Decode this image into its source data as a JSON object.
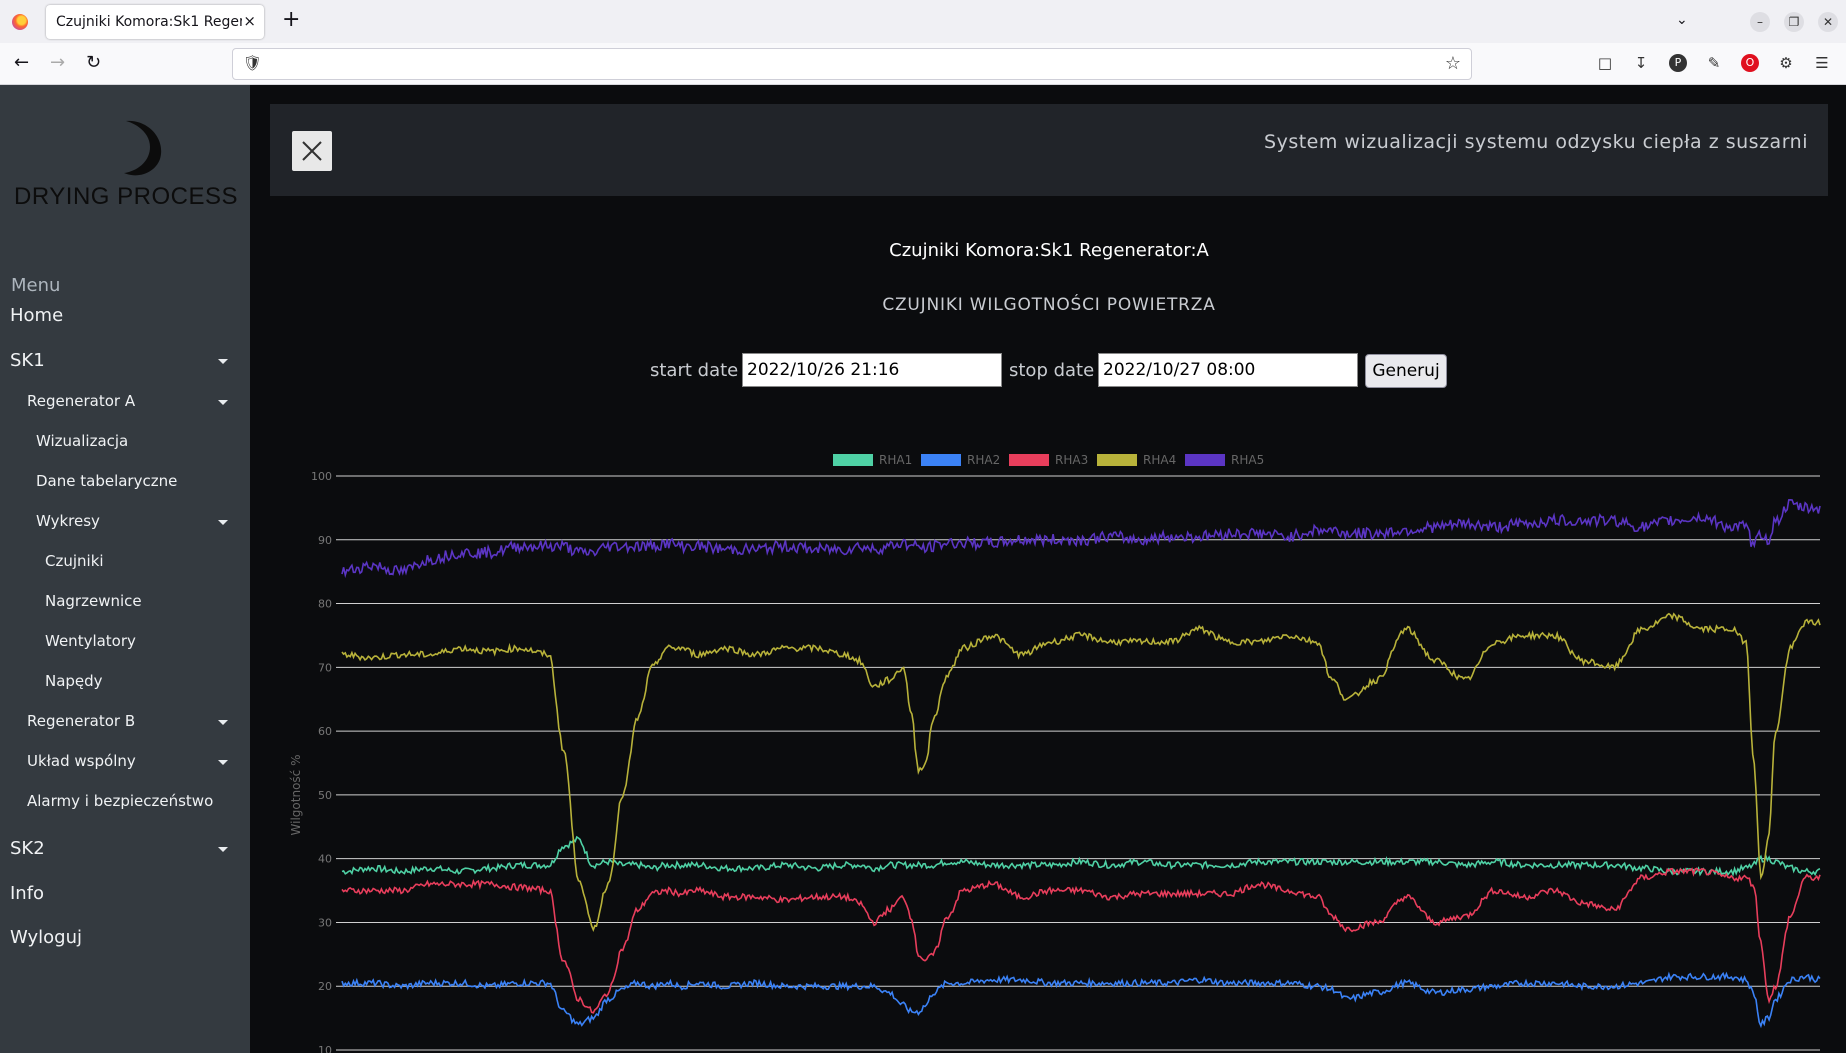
{
  "browser": {
    "tab_title": "Czujniki Komora:Sk1 Regenerator:A",
    "tab_close": "×",
    "new_tab": "+",
    "url": ""
  },
  "sidebar": {
    "brand": "DRYING PROCESS",
    "menu_label": "Menu",
    "items": [
      {
        "label": "Home",
        "level": 0,
        "caret": false
      },
      {
        "label": "SK1",
        "level": 0,
        "caret": true
      },
      {
        "label": "Regenerator A",
        "level": 1,
        "caret": true
      },
      {
        "label": "Wizualizacja",
        "level": 2,
        "caret": false
      },
      {
        "label": "Dane tabelaryczne",
        "level": 2,
        "caret": false
      },
      {
        "label": "Wykresy",
        "level": 2,
        "caret": true
      },
      {
        "label": "Czujniki",
        "level": 3,
        "caret": false
      },
      {
        "label": "Nagrzewnice",
        "level": 3,
        "caret": false
      },
      {
        "label": "Wentylatory",
        "level": 3,
        "caret": false
      },
      {
        "label": "Napędy",
        "level": 3,
        "caret": false
      },
      {
        "label": "Regenerator B",
        "level": 1,
        "caret": true
      },
      {
        "label": "Układ wspólny",
        "level": 1,
        "caret": true
      },
      {
        "label": "Alarmy i bezpieczeństwo",
        "level": 1,
        "caret": false
      },
      {
        "label": "SK2",
        "level": 0,
        "caret": true
      },
      {
        "label": "Info",
        "level": 0,
        "caret": false
      },
      {
        "label": "Wyloguj",
        "level": 0,
        "caret": false
      }
    ]
  },
  "header": {
    "system_title": "System wizualizacji systemu odzysku ciepła z suszarni"
  },
  "main": {
    "page_title": "Czujniki Komora:Sk1 Regenerator:A",
    "section_title": "CZUJNIKI WILGOTNOŚCI POWIETRZA",
    "start_label": "start date",
    "start_value": "2022/10/26 21:16",
    "stop_label": "stop date",
    "stop_value": "2022/10/27 08:00",
    "generate_label": "Generuj"
  },
  "chart_data": {
    "type": "line",
    "ylabel": "Wilgotność %",
    "xlabel": "",
    "ylim": [
      10,
      100
    ],
    "yticks": [
      100,
      90,
      80,
      70,
      60,
      50,
      40,
      30,
      20,
      10
    ],
    "grid": true,
    "legend_position": "top-center",
    "x_range": [
      "2022/10/26 21:16",
      "2022/10/27 08:00"
    ],
    "x": [
      0,
      0.02,
      0.04,
      0.06,
      0.08,
      0.1,
      0.12,
      0.14,
      0.15,
      0.16,
      0.17,
      0.18,
      0.19,
      0.2,
      0.21,
      0.22,
      0.23,
      0.24,
      0.26,
      0.28,
      0.3,
      0.32,
      0.34,
      0.35,
      0.36,
      0.37,
      0.38,
      0.385,
      0.39,
      0.395,
      0.4,
      0.41,
      0.42,
      0.44,
      0.46,
      0.48,
      0.5,
      0.52,
      0.54,
      0.56,
      0.58,
      0.6,
      0.62,
      0.64,
      0.66,
      0.67,
      0.68,
      0.7,
      0.72,
      0.74,
      0.76,
      0.78,
      0.8,
      0.82,
      0.84,
      0.86,
      0.88,
      0.9,
      0.92,
      0.94,
      0.95,
      0.955,
      0.96,
      0.965,
      0.97,
      0.98,
      0.99,
      1.0
    ],
    "series": [
      {
        "name": "RHA1",
        "color": "#4fd1a5",
        "values": [
          38,
          38.5,
          38,
          38.5,
          38,
          38.5,
          39,
          39,
          42,
          43,
          39,
          39.5,
          39,
          39,
          38.5,
          39,
          39,
          39,
          38.5,
          38.5,
          39,
          38.5,
          39,
          39,
          38.5,
          39,
          39,
          39,
          39,
          39,
          39,
          39.5,
          39.5,
          39,
          39,
          39,
          39.5,
          39,
          39.5,
          39,
          39,
          39,
          39.5,
          39.5,
          39.5,
          39.5,
          39.5,
          39.5,
          39.5,
          39.5,
          39,
          39.5,
          39,
          39,
          39,
          39,
          38.5,
          38,
          38,
          38,
          38.5,
          39,
          40,
          40,
          39.5,
          38.5,
          38,
          38
        ]
      },
      {
        "name": "RHA2",
        "color": "#3b82f6",
        "values": [
          20.5,
          20.5,
          20,
          20.5,
          20.5,
          20,
          20.5,
          20.5,
          16,
          14,
          15,
          18,
          19.5,
          20.5,
          20,
          20.5,
          20,
          20.5,
          20,
          20.5,
          20,
          20,
          20,
          20,
          20,
          19,
          17,
          16,
          16,
          17,
          19,
          20.5,
          20.5,
          21,
          21,
          20.5,
          20.5,
          20.5,
          20.5,
          20.5,
          21,
          20.5,
          20.5,
          20.5,
          20,
          19.5,
          18,
          19,
          20.5,
          19,
          19.5,
          20,
          20.5,
          20.5,
          20,
          20,
          20.5,
          21.5,
          21.5,
          21.5,
          21,
          19,
          14,
          15,
          18,
          21,
          21.5,
          21
        ]
      },
      {
        "name": "RHA3",
        "color": "#e83e5c",
        "values": [
          35,
          35,
          35,
          36,
          36,
          36,
          35.5,
          35,
          24,
          18,
          16,
          19,
          26,
          32,
          34.5,
          35,
          34.5,
          35,
          34,
          34,
          33.5,
          34,
          34,
          33,
          30,
          32,
          34,
          31,
          25,
          24,
          25,
          31,
          35,
          36,
          34,
          35,
          35,
          34,
          34.5,
          34.5,
          34.5,
          34.5,
          36,
          35,
          34,
          31,
          29,
          30,
          34,
          30,
          31,
          35,
          34,
          35,
          33,
          32,
          37,
          38,
          38,
          37,
          37,
          36,
          27,
          18,
          20,
          31,
          37,
          37
        ]
      },
      {
        "name": "RHA4",
        "color": "#b8b23a",
        "values": [
          72,
          71.5,
          72,
          72,
          73,
          72.5,
          73,
          72,
          57,
          37,
          29,
          36,
          50,
          62,
          70,
          73,
          73,
          72,
          73,
          72,
          73,
          73,
          72,
          71,
          67,
          68,
          70,
          63,
          54,
          55,
          62,
          69,
          73,
          75,
          72,
          74,
          75,
          74,
          74,
          74,
          76,
          74,
          74,
          75,
          74,
          68,
          65,
          68,
          76,
          71,
          68,
          74,
          75,
          75,
          71,
          70,
          76,
          78,
          76,
          76,
          74,
          56,
          37,
          43,
          60,
          73,
          77,
          77
        ]
      },
      {
        "name": "RHA5",
        "color": "#5b35c4",
        "values": [
          85,
          86,
          85,
          87,
          88,
          88,
          89,
          89,
          89,
          88,
          88,
          89,
          89,
          89,
          89,
          89.5,
          89,
          89,
          88.5,
          88.5,
          89,
          88.5,
          88.5,
          89,
          88.5,
          89,
          89.5,
          89,
          89,
          88.5,
          89,
          89.5,
          89.5,
          89.5,
          90,
          90,
          90,
          90.5,
          90,
          90.5,
          90.5,
          91,
          91,
          90.5,
          91.5,
          91.5,
          91,
          91,
          91.5,
          92,
          92.5,
          92,
          92.5,
          93,
          93,
          93,
          92,
          93,
          93.5,
          92,
          92,
          89,
          91,
          90,
          93,
          95.5,
          95,
          95
        ]
      }
    ]
  }
}
